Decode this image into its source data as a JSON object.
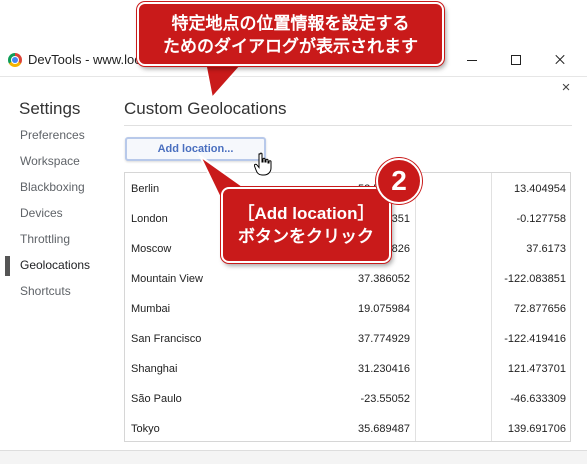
{
  "window": {
    "title": "DevTools - www.loca",
    "minimize": "minimize",
    "maximize": "maximize",
    "close": "close"
  },
  "dialog": {
    "close_glyph": "×"
  },
  "settings": {
    "title": "Settings",
    "nav": [
      "Preferences",
      "Workspace",
      "Blackboxing",
      "Devices",
      "Throttling",
      "Geolocations",
      "Shortcuts"
    ],
    "active_index": 5
  },
  "main": {
    "title": "Custom Geolocations",
    "add_button": "Add location..."
  },
  "locations": [
    {
      "name": "Berlin",
      "lat": "52.520007",
      "lng": "13.404954"
    },
    {
      "name": "London",
      "lat": "51.507351",
      "lng": "-0.127758"
    },
    {
      "name": "Moscow",
      "lat": "55.755826",
      "lng": "37.6173"
    },
    {
      "name": "Mountain View",
      "lat": "37.386052",
      "lng": "-122.083851"
    },
    {
      "name": "Mumbai",
      "lat": "19.075984",
      "lng": "72.877656"
    },
    {
      "name": "San Francisco",
      "lat": "37.774929",
      "lng": "-122.419416"
    },
    {
      "name": "Shanghai",
      "lat": "31.230416",
      "lng": "121.473701"
    },
    {
      "name": "São Paulo",
      "lat": "-23.55052",
      "lng": "-46.633309"
    },
    {
      "name": "Tokyo",
      "lat": "35.689487",
      "lng": "139.691706"
    }
  ],
  "annotations": {
    "top_line1": "特定地点の位置情報を設定する",
    "top_line2": "ためのダイアログが表示されます",
    "step_number": "2",
    "step_line1": "［Add location］",
    "step_line2": "ボタンをクリック",
    "accent_color": "#c91a1a"
  }
}
